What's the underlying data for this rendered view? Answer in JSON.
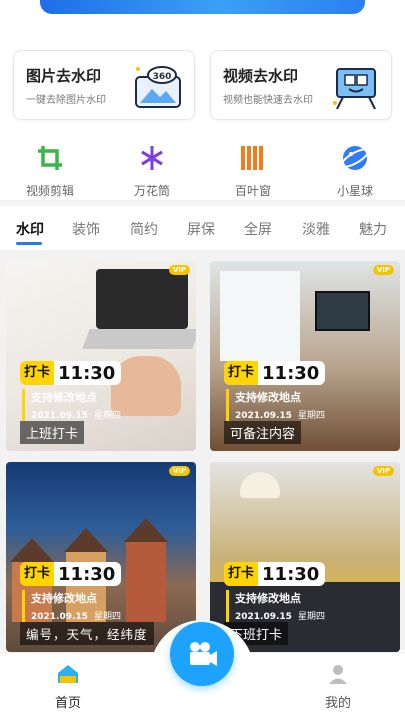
{
  "features": [
    {
      "title": "图片去水印",
      "subtitle": "一键去除图片水印",
      "icon": "360-image-icon"
    },
    {
      "title": "视频去水印",
      "subtitle": "视频也能快速去水印",
      "icon": "video-board-icon"
    }
  ],
  "tools": [
    {
      "label": "视频剪辑",
      "icon": "crop-icon",
      "color": "#3bb54a"
    },
    {
      "label": "万花筒",
      "icon": "kaleidoscope-icon",
      "color": "#7b3fe4"
    },
    {
      "label": "百叶窗",
      "icon": "blinds-icon",
      "color": "#f07c1b"
    },
    {
      "label": "小星球",
      "icon": "planet-icon",
      "color": "#2f7cf6"
    }
  ],
  "tabs": [
    "水印",
    "装饰",
    "简约",
    "屏保",
    "全屏",
    "淡雅",
    "魅力"
  ],
  "active_tab": "水印",
  "cards": [
    {
      "vip": "VIP",
      "tag": "打卡",
      "time": "11:30",
      "place": "支持修改地点",
      "date": "2021.09.15",
      "weekday": "星期四",
      "caption": "上班打卡"
    },
    {
      "vip": "VIP",
      "tag": "打卡",
      "time": "11:30",
      "place": "支持修改地点",
      "date": "2021.09.15",
      "weekday": "星期四",
      "caption": "可备注内容"
    },
    {
      "vip": "VIP",
      "tag": "打卡",
      "time": "11:30",
      "place": "支持修改地点",
      "date": "2021.09.15",
      "weekday": "星期四",
      "caption": "编号，天气，经纬度"
    },
    {
      "vip": "VIP",
      "tag": "打卡",
      "time": "11:30",
      "place": "支持修改地点",
      "date": "2021.09.15",
      "weekday": "星期四",
      "caption": "下班打卡"
    }
  ],
  "nav": {
    "home": "首页",
    "me": "我的",
    "accent": "#1ea2ff"
  }
}
